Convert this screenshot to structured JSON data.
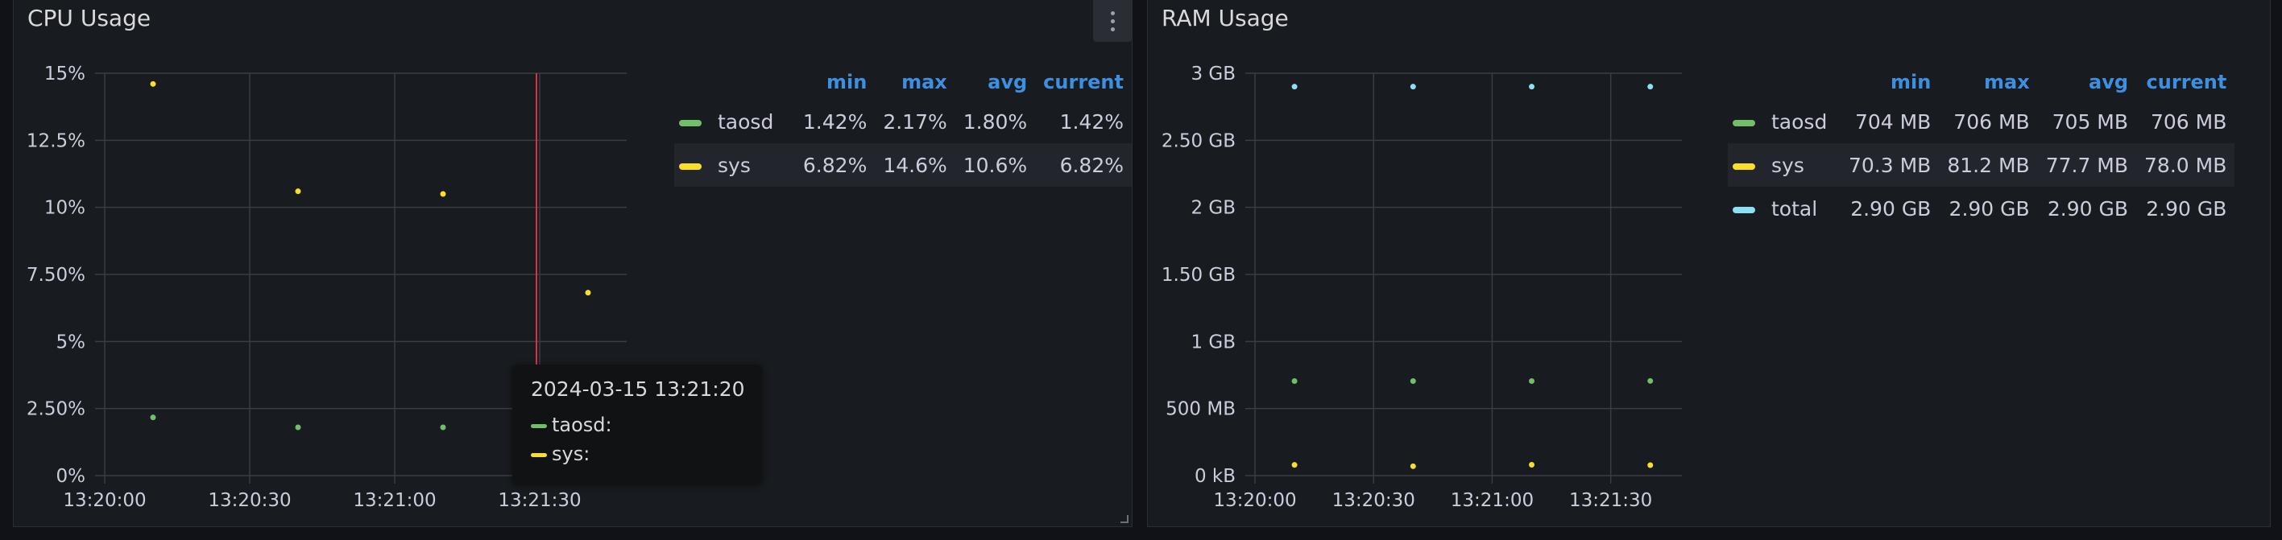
{
  "colors": {
    "taosd": "#73bf69",
    "sys": "#fade2a",
    "total": "#8ae0f5",
    "cursor": "#e02f44",
    "grid": "#3b3d43",
    "axis_text": "#ccccdc"
  },
  "cpu_panel": {
    "title": "CPU Usage",
    "menu_icon": "kebab-menu-icon",
    "legend": {
      "headers": [
        "min",
        "max",
        "avg",
        "current"
      ],
      "rows": [
        {
          "name": "taosd",
          "min": "1.42%",
          "max": "2.17%",
          "avg": "1.80%",
          "current": "1.42%"
        },
        {
          "name": "sys",
          "min": "6.82%",
          "max": "14.6%",
          "avg": "10.6%",
          "current": "6.82%"
        }
      ]
    },
    "tooltip": {
      "title": "2024-03-15 13:21:20",
      "rows": [
        {
          "label": "taosd:"
        },
        {
          "label": "sys:"
        }
      ]
    }
  },
  "ram_panel": {
    "title": "RAM Usage",
    "legend": {
      "headers": [
        "min",
        "max",
        "avg",
        "current"
      ],
      "rows": [
        {
          "name": "taosd",
          "min": "704 MB",
          "max": "706 MB",
          "avg": "705 MB",
          "current": "706 MB"
        },
        {
          "name": "sys",
          "min": "70.3 MB",
          "max": "81.2 MB",
          "avg": "77.7 MB",
          "current": "78.0 MB"
        },
        {
          "name": "total",
          "min": "2.90 GB",
          "max": "2.90 GB",
          "avg": "2.90 GB",
          "current": "2.90 GB"
        }
      ]
    }
  },
  "chart_data": [
    {
      "type": "scatter",
      "title": "CPU Usage",
      "x_unit": "time",
      "x_ticks": [
        "13:20:00",
        "13:20:30",
        "13:21:00",
        "13:21:30"
      ],
      "xlim": [
        "13:20:00",
        "13:21:48"
      ],
      "y_ticks": [
        "0%",
        "2.50%",
        "5%",
        "7.50%",
        "10%",
        "12.5%",
        "15%"
      ],
      "ylim": [
        0,
        15
      ],
      "grid": true,
      "cursor_time": "13:21:30",
      "series": [
        {
          "name": "taosd",
          "color": "#73bf69",
          "points": [
            [
              "13:20:10",
              2.17
            ],
            [
              "13:20:40",
              1.8
            ],
            [
              "13:21:10",
              1.8
            ]
          ]
        },
        {
          "name": "sys",
          "color": "#fade2a",
          "points": [
            [
              "13:20:10",
              14.6
            ],
            [
              "13:20:40",
              10.6
            ],
            [
              "13:21:10",
              10.5
            ],
            [
              "13:21:40",
              6.82
            ]
          ]
        }
      ]
    },
    {
      "type": "scatter",
      "title": "RAM Usage",
      "x_unit": "time",
      "x_ticks": [
        "13:20:00",
        "13:20:30",
        "13:21:00",
        "13:21:30"
      ],
      "xlim": [
        "13:20:00",
        "13:21:48"
      ],
      "y_ticks": [
        "0 kB",
        "500 MB",
        "1 GB",
        "1.50 GB",
        "2 GB",
        "2.50 GB",
        "3 GB"
      ],
      "ylim": [
        0,
        3
      ],
      "y_unit": "GB",
      "grid": true,
      "series": [
        {
          "name": "taosd",
          "color": "#73bf69",
          "points": [
            [
              "13:20:10",
              0.705
            ],
            [
              "13:20:40",
              0.705
            ],
            [
              "13:21:10",
              0.705
            ],
            [
              "13:21:40",
              0.706
            ]
          ]
        },
        {
          "name": "sys",
          "color": "#fade2a",
          "points": [
            [
              "13:20:10",
              0.08
            ],
            [
              "13:20:40",
              0.07
            ],
            [
              "13:21:10",
              0.081
            ],
            [
              "13:21:40",
              0.078
            ]
          ]
        },
        {
          "name": "total",
          "color": "#8ae0f5",
          "points": [
            [
              "13:20:10",
              2.9
            ],
            [
              "13:20:40",
              2.9
            ],
            [
              "13:21:10",
              2.9
            ],
            [
              "13:21:40",
              2.9
            ]
          ]
        }
      ]
    }
  ]
}
